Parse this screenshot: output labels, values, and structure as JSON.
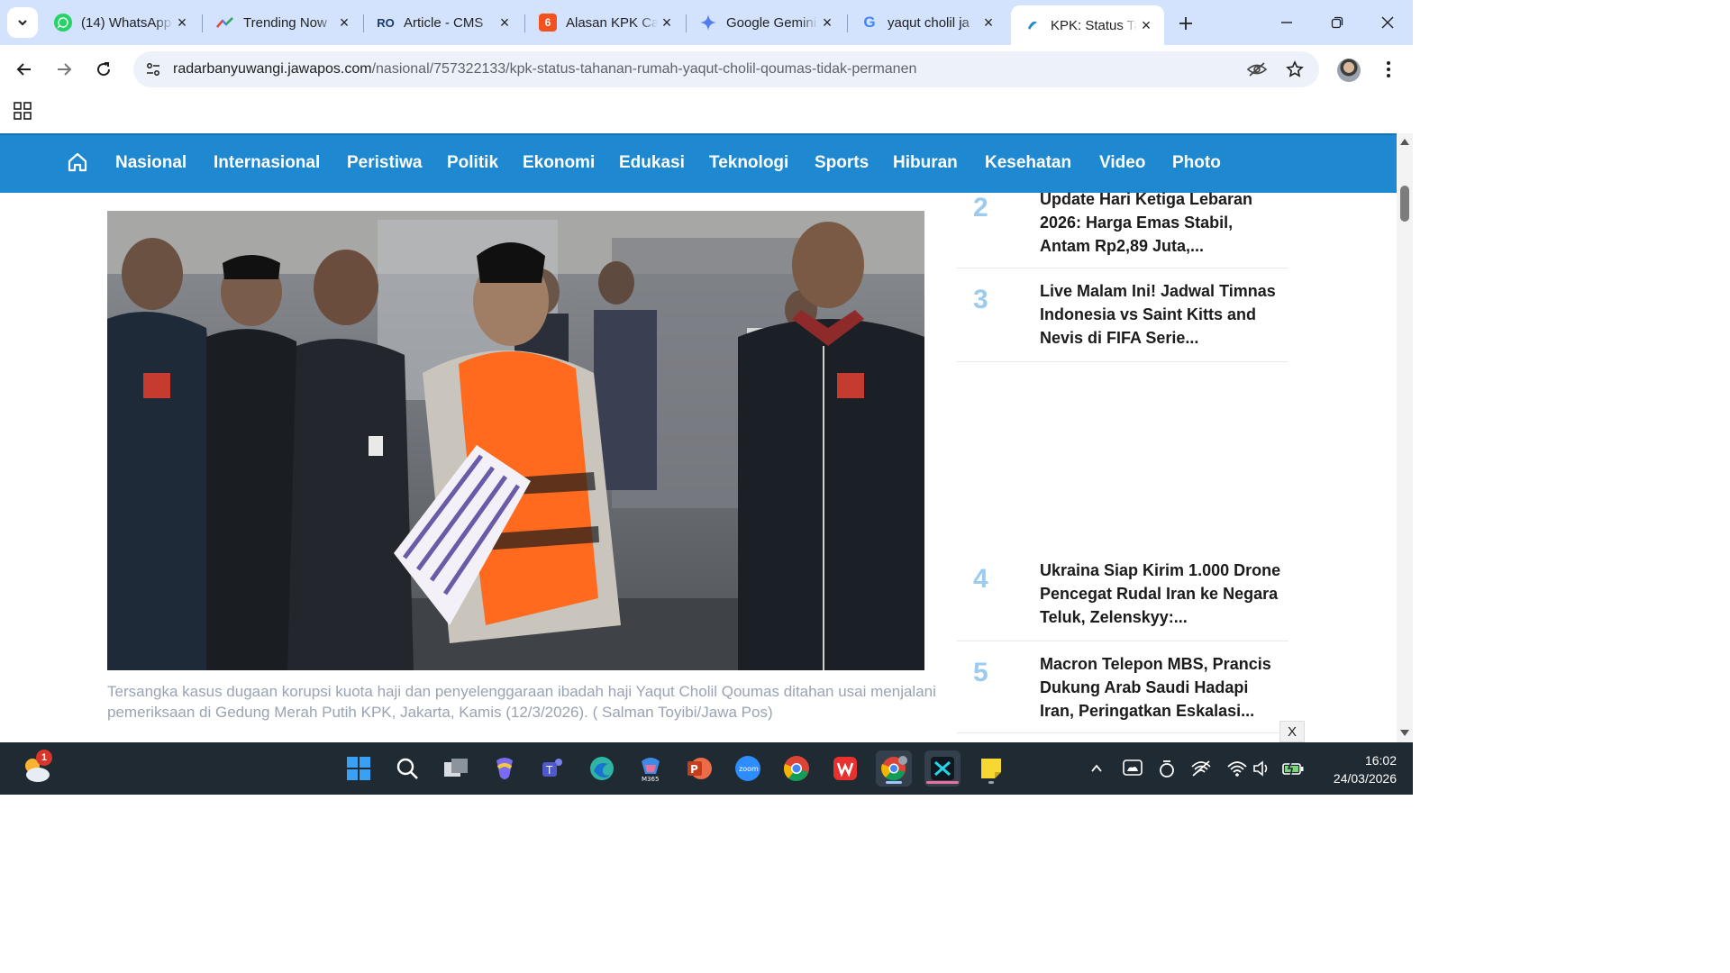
{
  "browser": {
    "tabs": [
      {
        "title": "(14) WhatsApp",
        "icon": "whatsapp-icon",
        "color": "#25d366"
      },
      {
        "title": "Trending Now",
        "icon": "trending-icon",
        "color": "#4285f4"
      },
      {
        "title": "Article - CMS",
        "icon": "cms-icon",
        "color": "#1a73e8"
      },
      {
        "title": "Alasan KPK Ca",
        "icon": "news-6-icon",
        "color": "#f4511e"
      },
      {
        "title": "Google Gemini",
        "icon": "gemini-icon",
        "color": "#4e7df2"
      },
      {
        "title": "yaqut cholil ja",
        "icon": "google-icon",
        "color": "#4285f4"
      },
      {
        "title": "KPK: Status Ta",
        "icon": "jawapos-icon",
        "color": "#1e88d0"
      }
    ],
    "url_host": "radarbanyuwangi.jawapos.com",
    "url_path": "/nasional/757322133/kpk-status-tahanan-rumah-yaqut-cholil-qoumas-tidak-permanen"
  },
  "site_nav": {
    "items": [
      "Nasional",
      "Internasional",
      "Peristiwa",
      "Politik",
      "Ekonomi",
      "Edukasi",
      "Teknologi",
      "Sports",
      "Hiburan",
      "Kesehatan",
      "Video",
      "Photo"
    ]
  },
  "article": {
    "caption": "Tersangka kasus dugaan korupsi kuota haji dan penyelenggaraan ibadah haji Yaqut Cholil Qoumas ditahan usai menjalani pemeriksaan di Gedung Merah Putih KPK, Jakarta, Kamis (12/3/2026). ( Salman Toyibi/Jawa Pos)"
  },
  "popular": [
    {
      "num": "2",
      "title": "Update Hari Ketiga Lebaran 2026: Harga Emas Stabil, Antam Rp2,89 Juta,..."
    },
    {
      "num": "3",
      "title": "Live Malam Ini! Jadwal Timnas Indonesia vs Saint Kitts and Nevis di FIFA Serie..."
    },
    {
      "num": "4",
      "title": "Ukraina Siap Kirim 1.000 Drone Pencegat Rudal Iran ke Negara Teluk, Zelenskyy:..."
    },
    {
      "num": "5",
      "title": "Macron Telepon MBS, Prancis Dukung Arab Saudi Hadapi Iran, Peringatkan Eskalasi..."
    }
  ],
  "ad_close_label": "X",
  "taskbar": {
    "weather_badge": "1",
    "time": "16:02",
    "date": "24/03/2026"
  },
  "colors": {
    "site_nav": "#1e88d0",
    "news_number": "#9ccbee",
    "tabstrip": "#d3e3fd"
  }
}
